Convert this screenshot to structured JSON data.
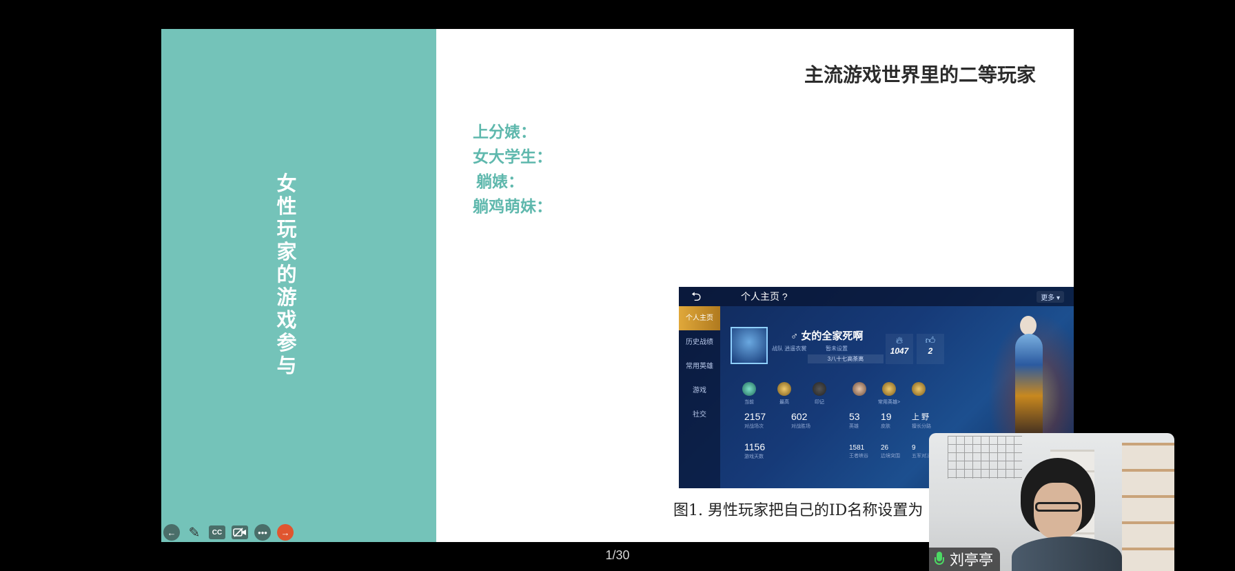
{
  "slide": {
    "title": "主流游戏世界里的二等玩家",
    "vertical_title": "女性玩家的游戏参与",
    "terms": [
      "上分婊：",
      "女大学生：",
      "躺婊：",
      "躺鸡萌妹："
    ],
    "caption": "图1. 男性玩家把自己的ID名称设置为"
  },
  "game_screenshot": {
    "header_title": "个人主页",
    "help_mark": "?",
    "more_label": "更多",
    "sidebar": [
      "个人主页",
      "历史战绩",
      "常用英雄",
      "游戏",
      "社交"
    ],
    "player_name": "女的全家死啊",
    "sub_left": "战队 逍遥衣裳",
    "sub_right": "暂未设置",
    "rank_text": "3八十七高茶离",
    "heat_value": "1047",
    "likes_value": "2",
    "badges": [
      {
        "label": "当前"
      },
      {
        "label": "最高"
      },
      {
        "label": "印记"
      },
      {
        "label": ""
      },
      {
        "label": "常用英雄>"
      },
      {
        "label": ""
      }
    ],
    "stats": [
      {
        "value": "2157",
        "label": "对战场次"
      },
      {
        "value": "602",
        "label": "对战胜场"
      },
      {
        "value": "53",
        "label": "英雄"
      },
      {
        "value": "19",
        "label": "皮肤"
      },
      {
        "value": "上 野",
        "label": "擅长分路"
      },
      {
        "value": "1156",
        "label": "游戏天数"
      },
      {
        "value": "1581",
        "label": "王者峡谷"
      },
      {
        "value": "26",
        "label": "边境突围"
      },
      {
        "value": "9",
        "label": "五军对决"
      }
    ]
  },
  "toolbar": {
    "buttons": [
      "back-icon",
      "pen-icon",
      "cc-icon",
      "camera-off-icon",
      "more-icon",
      "exit-icon"
    ],
    "cc_label": "CC"
  },
  "page_indicator": "1/30",
  "video": {
    "participant_name": "刘亭亭",
    "mic_color": "#4cd964"
  },
  "colors": {
    "accent_teal": "#74c3b9",
    "term_teal": "#5fb8ad",
    "exit_orange": "#e0552f"
  }
}
